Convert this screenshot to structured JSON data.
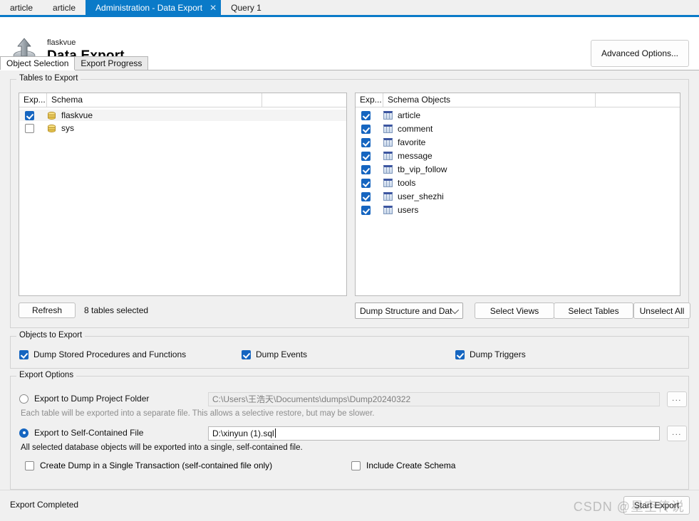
{
  "window_tabs": [
    {
      "label": "article",
      "active": false,
      "closable": false
    },
    {
      "label": "article",
      "active": false,
      "closable": false
    },
    {
      "label": "Administration - Data Export",
      "active": true,
      "closable": true,
      "close_glyph": "✕"
    },
    {
      "label": "Query 1",
      "active": false,
      "closable": false
    }
  ],
  "header": {
    "schema": "flaskvue",
    "title": "Data Export",
    "advanced_options_label": "Advanced Options..."
  },
  "inner_tabs": [
    {
      "label": "Object Selection",
      "active": true
    },
    {
      "label": "Export Progress",
      "active": false
    }
  ],
  "tables_group": {
    "legend": "Tables to Export",
    "left_list": {
      "columns": [
        "Exp...",
        "Schema",
        ""
      ],
      "rows": [
        {
          "checked": true,
          "name": "flaskvue",
          "selected": true
        },
        {
          "checked": false,
          "name": "sys",
          "selected": false
        }
      ]
    },
    "right_list": {
      "columns": [
        "Exp...",
        "Schema Objects",
        ""
      ],
      "rows": [
        {
          "checked": true,
          "name": "article"
        },
        {
          "checked": true,
          "name": "comment"
        },
        {
          "checked": true,
          "name": "favorite"
        },
        {
          "checked": true,
          "name": "message"
        },
        {
          "checked": true,
          "name": "tb_vip_follow"
        },
        {
          "checked": true,
          "name": "tools"
        },
        {
          "checked": true,
          "name": "user_shezhi"
        },
        {
          "checked": true,
          "name": "users"
        }
      ]
    },
    "refresh_label": "Refresh",
    "selected_count_text": "8 tables selected",
    "dump_mode_value": "Dump Structure and Dat",
    "select_views_label": "Select Views",
    "select_tables_label": "Select Tables",
    "unselect_all_label": "Unselect All"
  },
  "objects_group": {
    "legend": "Objects to Export",
    "options": [
      {
        "label": "Dump Stored Procedures and Functions",
        "checked": true
      },
      {
        "label": "Dump Events",
        "checked": true
      },
      {
        "label": "Dump Triggers",
        "checked": true
      }
    ]
  },
  "export_group": {
    "legend": "Export Options",
    "dump_project_folder": {
      "label": "Export to Dump Project Folder",
      "selected": false,
      "path": "C:\\Users\\王浩天\\Documents\\dumps\\Dump20240322",
      "browse_label": "...",
      "hint": "Each table will be exported into a separate file. This allows a selective restore, but may be slower."
    },
    "self_contained_file": {
      "label": "Export to Self-Contained File",
      "selected": true,
      "path": "D:\\xinyun (1).sql",
      "browse_label": "...",
      "hint": "All selected database objects will be exported into a single, self-contained file."
    },
    "single_transaction": {
      "label": "Create Dump in a Single Transaction (self-contained file only)",
      "checked": false
    },
    "include_create_schema": {
      "label": "Include Create Schema",
      "checked": false
    }
  },
  "bottom": {
    "status": "Export Completed",
    "start_export_label": "Start Export",
    "watermark": "CSDN @星空传说"
  },
  "colors": {
    "accent_blue": "#0a7ac8",
    "checkbox_blue": "#1565c0",
    "panel_gray": "#f0f0f0"
  }
}
